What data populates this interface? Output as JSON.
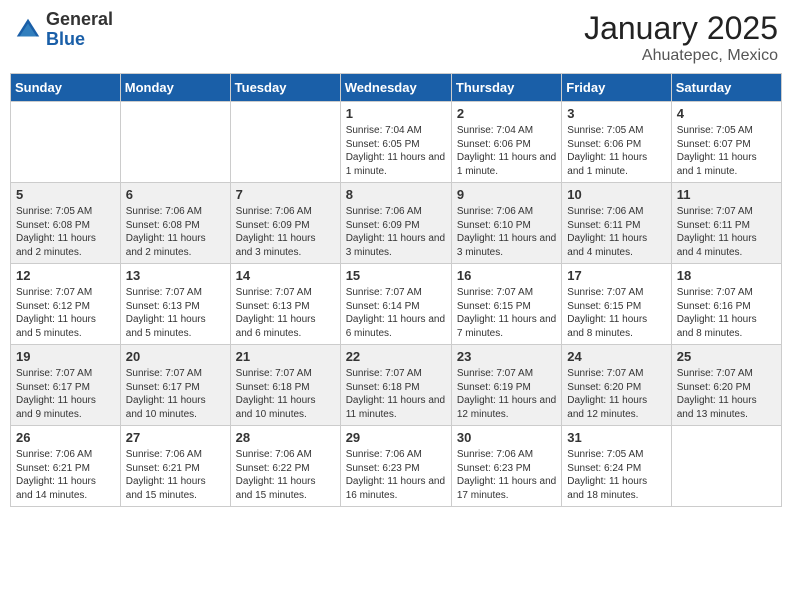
{
  "header": {
    "logo_general": "General",
    "logo_blue": "Blue",
    "month": "January 2025",
    "location": "Ahuatepec, Mexico"
  },
  "weekdays": [
    "Sunday",
    "Monday",
    "Tuesday",
    "Wednesday",
    "Thursday",
    "Friday",
    "Saturday"
  ],
  "weeks": [
    [
      {
        "day": "",
        "info": ""
      },
      {
        "day": "",
        "info": ""
      },
      {
        "day": "",
        "info": ""
      },
      {
        "day": "1",
        "info": "Sunrise: 7:04 AM\nSunset: 6:05 PM\nDaylight: 11 hours and 1 minute."
      },
      {
        "day": "2",
        "info": "Sunrise: 7:04 AM\nSunset: 6:06 PM\nDaylight: 11 hours and 1 minute."
      },
      {
        "day": "3",
        "info": "Sunrise: 7:05 AM\nSunset: 6:06 PM\nDaylight: 11 hours and 1 minute."
      },
      {
        "day": "4",
        "info": "Sunrise: 7:05 AM\nSunset: 6:07 PM\nDaylight: 11 hours and 1 minute."
      }
    ],
    [
      {
        "day": "5",
        "info": "Sunrise: 7:05 AM\nSunset: 6:08 PM\nDaylight: 11 hours and 2 minutes."
      },
      {
        "day": "6",
        "info": "Sunrise: 7:06 AM\nSunset: 6:08 PM\nDaylight: 11 hours and 2 minutes."
      },
      {
        "day": "7",
        "info": "Sunrise: 7:06 AM\nSunset: 6:09 PM\nDaylight: 11 hours and 3 minutes."
      },
      {
        "day": "8",
        "info": "Sunrise: 7:06 AM\nSunset: 6:09 PM\nDaylight: 11 hours and 3 minutes."
      },
      {
        "day": "9",
        "info": "Sunrise: 7:06 AM\nSunset: 6:10 PM\nDaylight: 11 hours and 3 minutes."
      },
      {
        "day": "10",
        "info": "Sunrise: 7:06 AM\nSunset: 6:11 PM\nDaylight: 11 hours and 4 minutes."
      },
      {
        "day": "11",
        "info": "Sunrise: 7:07 AM\nSunset: 6:11 PM\nDaylight: 11 hours and 4 minutes."
      }
    ],
    [
      {
        "day": "12",
        "info": "Sunrise: 7:07 AM\nSunset: 6:12 PM\nDaylight: 11 hours and 5 minutes."
      },
      {
        "day": "13",
        "info": "Sunrise: 7:07 AM\nSunset: 6:13 PM\nDaylight: 11 hours and 5 minutes."
      },
      {
        "day": "14",
        "info": "Sunrise: 7:07 AM\nSunset: 6:13 PM\nDaylight: 11 hours and 6 minutes."
      },
      {
        "day": "15",
        "info": "Sunrise: 7:07 AM\nSunset: 6:14 PM\nDaylight: 11 hours and 6 minutes."
      },
      {
        "day": "16",
        "info": "Sunrise: 7:07 AM\nSunset: 6:15 PM\nDaylight: 11 hours and 7 minutes."
      },
      {
        "day": "17",
        "info": "Sunrise: 7:07 AM\nSunset: 6:15 PM\nDaylight: 11 hours and 8 minutes."
      },
      {
        "day": "18",
        "info": "Sunrise: 7:07 AM\nSunset: 6:16 PM\nDaylight: 11 hours and 8 minutes."
      }
    ],
    [
      {
        "day": "19",
        "info": "Sunrise: 7:07 AM\nSunset: 6:17 PM\nDaylight: 11 hours and 9 minutes."
      },
      {
        "day": "20",
        "info": "Sunrise: 7:07 AM\nSunset: 6:17 PM\nDaylight: 11 hours and 10 minutes."
      },
      {
        "day": "21",
        "info": "Sunrise: 7:07 AM\nSunset: 6:18 PM\nDaylight: 11 hours and 10 minutes."
      },
      {
        "day": "22",
        "info": "Sunrise: 7:07 AM\nSunset: 6:18 PM\nDaylight: 11 hours and 11 minutes."
      },
      {
        "day": "23",
        "info": "Sunrise: 7:07 AM\nSunset: 6:19 PM\nDaylight: 11 hours and 12 minutes."
      },
      {
        "day": "24",
        "info": "Sunrise: 7:07 AM\nSunset: 6:20 PM\nDaylight: 11 hours and 12 minutes."
      },
      {
        "day": "25",
        "info": "Sunrise: 7:07 AM\nSunset: 6:20 PM\nDaylight: 11 hours and 13 minutes."
      }
    ],
    [
      {
        "day": "26",
        "info": "Sunrise: 7:06 AM\nSunset: 6:21 PM\nDaylight: 11 hours and 14 minutes."
      },
      {
        "day": "27",
        "info": "Sunrise: 7:06 AM\nSunset: 6:21 PM\nDaylight: 11 hours and 15 minutes."
      },
      {
        "day": "28",
        "info": "Sunrise: 7:06 AM\nSunset: 6:22 PM\nDaylight: 11 hours and 15 minutes."
      },
      {
        "day": "29",
        "info": "Sunrise: 7:06 AM\nSunset: 6:23 PM\nDaylight: 11 hours and 16 minutes."
      },
      {
        "day": "30",
        "info": "Sunrise: 7:06 AM\nSunset: 6:23 PM\nDaylight: 11 hours and 17 minutes."
      },
      {
        "day": "31",
        "info": "Sunrise: 7:05 AM\nSunset: 6:24 PM\nDaylight: 11 hours and 18 minutes."
      },
      {
        "day": "",
        "info": ""
      }
    ]
  ]
}
